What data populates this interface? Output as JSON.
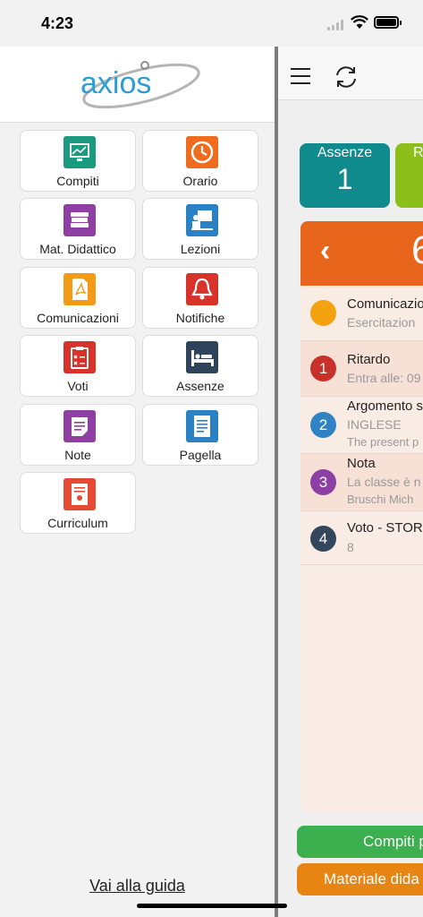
{
  "status_bar": {
    "time": "4:23"
  },
  "sidebar": {
    "logo_text": "axios",
    "tiles": [
      {
        "label": "Compiti",
        "icon": "chalkboard-icon",
        "color": "#1a9a7e"
      },
      {
        "label": "Orario",
        "icon": "clock-icon",
        "color": "#ef6b1d"
      },
      {
        "label": "Mat. Didattico",
        "icon": "books-icon",
        "color": "#8f3fa3"
      },
      {
        "label": "Lezioni",
        "icon": "teacher-board-icon",
        "color": "#2a82c4"
      },
      {
        "label": "Comunicazioni",
        "icon": "pdf-document-icon",
        "color": "#f39a16"
      },
      {
        "label": "Notifiche",
        "icon": "bell-icon",
        "color": "#d8332b"
      },
      {
        "label": "Voti",
        "icon": "clipboard-grades-icon",
        "color": "#d8332b"
      },
      {
        "label": "Assenze",
        "icon": "bed-icon",
        "color": "#2f435a"
      },
      {
        "label": "Note",
        "icon": "note-icon",
        "color": "#8f3fa3"
      },
      {
        "label": "Pagella",
        "icon": "report-card-icon",
        "color": "#2a82c4"
      },
      {
        "label": "Curriculum",
        "icon": "certificate-icon",
        "color": "#e44a34"
      }
    ],
    "guide_link": "Vai alla guida"
  },
  "main": {
    "cards": [
      {
        "title": "Assenze",
        "value": "1"
      },
      {
        "title": "R",
        "value": ""
      }
    ],
    "panel": {
      "day": "6"
    },
    "items": [
      {
        "marker": "",
        "title": "Comunicazio",
        "sub": "Esercitazion",
        "sub2": "",
        "color": "#f4a20f"
      },
      {
        "marker": "1",
        "title": "Ritardo",
        "sub": "Entra alle: 09",
        "sub2": "",
        "color": "#c8302a"
      },
      {
        "marker": "2",
        "title": "Argomento s",
        "sub": "INGLESE",
        "sub2": "The present p",
        "color": "#2f82c4"
      },
      {
        "marker": "3",
        "title": "Nota",
        "sub": "La classe è n",
        "sub2": "Bruschi Mich",
        "color": "#8e3fa5"
      },
      {
        "marker": "4",
        "title": "Voto - STOR",
        "sub": "8",
        "sub2": "",
        "color": "#34465c"
      }
    ],
    "buttons": {
      "compiti": "Compiti p",
      "materiale": "Materiale dida"
    }
  }
}
